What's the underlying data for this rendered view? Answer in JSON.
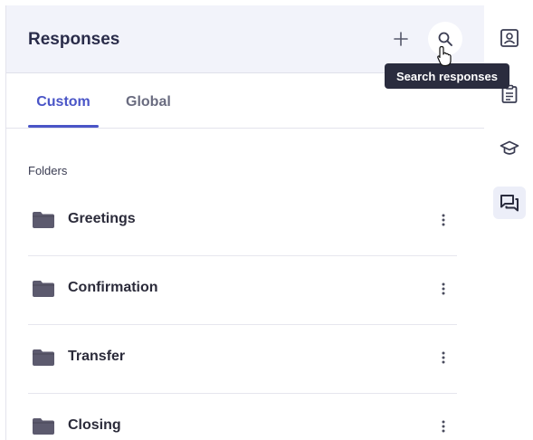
{
  "header": {
    "title": "Responses",
    "add_icon": "plus-icon",
    "search_icon": "search-icon",
    "search_tooltip": "Search responses"
  },
  "tabs": [
    {
      "label": "Custom",
      "active": true
    },
    {
      "label": "Global",
      "active": false
    }
  ],
  "folders": {
    "section_label": "Folders",
    "items": [
      {
        "name": "Greetings"
      },
      {
        "name": "Confirmation"
      },
      {
        "name": "Transfer"
      },
      {
        "name": "Closing"
      }
    ]
  },
  "side_rail": {
    "items": [
      {
        "icon": "contact-card-icon",
        "active": false
      },
      {
        "icon": "clipboard-icon",
        "active": false
      },
      {
        "icon": "graduation-cap-icon",
        "active": false
      },
      {
        "icon": "chat-bubbles-icon",
        "active": true
      }
    ]
  },
  "colors": {
    "accent": "#4a55c7",
    "header_bg": "#f2f3fa",
    "tooltip_bg": "#2a2c3e",
    "folder_icon": "#5c5a6e"
  }
}
